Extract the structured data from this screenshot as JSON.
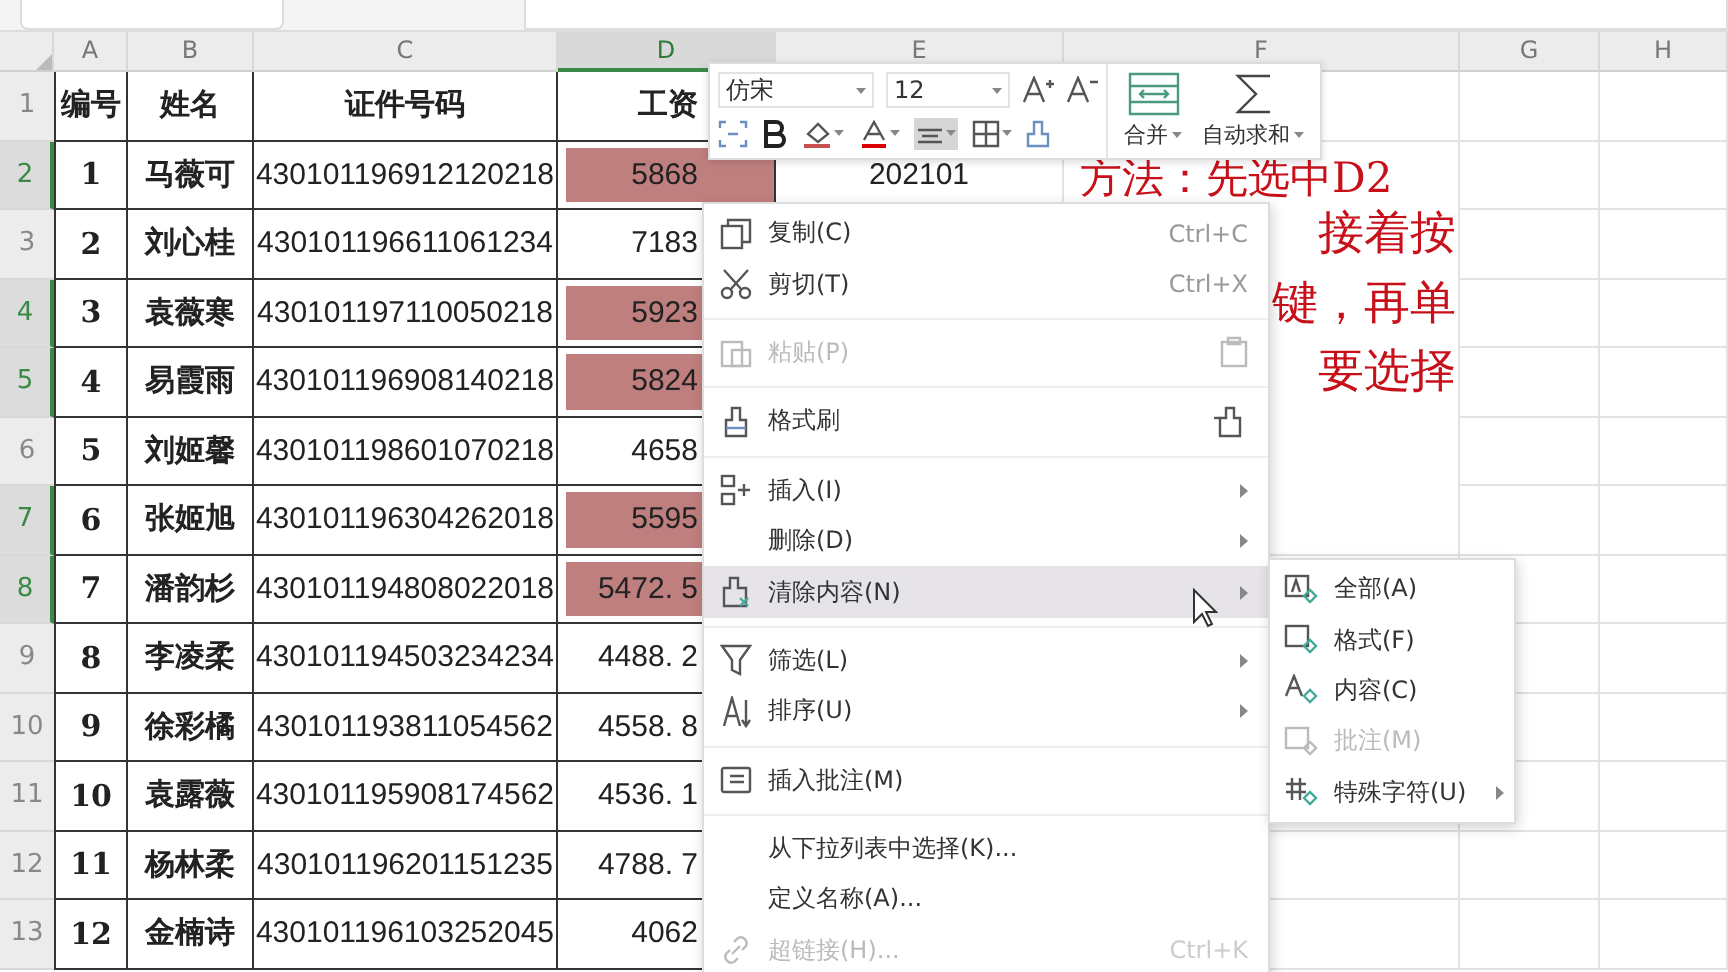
{
  "column_headers": [
    {
      "label": "A",
      "selected": false
    },
    {
      "label": "B",
      "selected": false
    },
    {
      "label": "C",
      "selected": false
    },
    {
      "label": "D",
      "selected": true
    },
    {
      "label": "E",
      "selected": false
    },
    {
      "label": "F",
      "selected": false
    },
    {
      "label": "G",
      "selected": false
    },
    {
      "label": "H",
      "selected": false
    }
  ],
  "rows": [
    {
      "row_number": "1",
      "selected": false,
      "kind": "header",
      "id": "编号",
      "name": "姓名",
      "id_number": "证件号码",
      "salary": "工资",
      "highlighted": false
    },
    {
      "row_number": "2",
      "selected": true,
      "kind": "data",
      "id": "1",
      "name": "马薇可",
      "id_number": "430101196912120218",
      "salary": "5868",
      "highlighted": true,
      "column_e": "202101"
    },
    {
      "row_number": "3",
      "selected": false,
      "kind": "data",
      "id": "2",
      "name": "刘心桂",
      "id_number": "430101196611061234",
      "salary": "7183",
      "highlighted": false
    },
    {
      "row_number": "4",
      "selected": true,
      "kind": "data",
      "id": "3",
      "name": "袁薇寒",
      "id_number": "430101197110050218",
      "salary": "5923",
      "highlighted": true
    },
    {
      "row_number": "5",
      "selected": true,
      "kind": "data",
      "id": "4",
      "name": "易霞雨",
      "id_number": "430101196908140218",
      "salary": "5824",
      "highlighted": true
    },
    {
      "row_number": "6",
      "selected": false,
      "kind": "data",
      "id": "5",
      "name": "刘姬馨",
      "id_number": "430101198601070218",
      "salary": "4658",
      "highlighted": false
    },
    {
      "row_number": "7",
      "selected": true,
      "kind": "data",
      "id": "6",
      "name": "张姬旭",
      "id_number": "430101196304262018",
      "salary": "5595",
      "highlighted": true
    },
    {
      "row_number": "8",
      "selected": true,
      "kind": "data",
      "id": "7",
      "name": "潘韵杉",
      "id_number": "430101194808022018",
      "salary": "5472. 5",
      "highlighted": true
    },
    {
      "row_number": "9",
      "selected": false,
      "kind": "data",
      "id": "8",
      "name": "李凌柔",
      "id_number": "430101194503234234",
      "salary": "4488. 2",
      "highlighted": false
    },
    {
      "row_number": "10",
      "selected": false,
      "kind": "data",
      "id": "9",
      "name": "徐彩橘",
      "id_number": "430101193811054562",
      "salary": "4558. 8",
      "highlighted": false
    },
    {
      "row_number": "11",
      "selected": false,
      "kind": "data",
      "id": "10",
      "name": "袁露薇",
      "id_number": "430101195908174562",
      "salary": "4536. 1",
      "highlighted": false
    },
    {
      "row_number": "12",
      "selected": false,
      "kind": "data",
      "id": "11",
      "name": "杨林柔",
      "id_number": "430101196201151235",
      "salary": "4788. 7",
      "highlighted": false
    },
    {
      "row_number": "13",
      "selected": false,
      "kind": "data",
      "id": "12",
      "name": "金楠诗",
      "id_number": "430101196103252045",
      "salary": "4062",
      "highlighted": false
    }
  ],
  "note_lines": [
    "方法：先选中D2",
    "接着按",
    "键，再单",
    "要选择"
  ],
  "mini_toolbar": {
    "font": "仿宋",
    "size": "12",
    "merge": "合并",
    "autosum": "自动求和"
  },
  "context_menu": [
    {
      "kind": "item",
      "label": "复制(C)",
      "shortcut": "Ctrl+C",
      "disabled": false,
      "selected": false,
      "has_submenu": false
    },
    {
      "kind": "item",
      "label": "剪切(T)",
      "shortcut": "Ctrl+X",
      "disabled": false,
      "selected": false,
      "has_submenu": false
    },
    {
      "kind": "separator"
    },
    {
      "kind": "item",
      "label": "粘贴(P)",
      "disabled": true,
      "selected": false,
      "has_submenu": false
    },
    {
      "kind": "separator"
    },
    {
      "kind": "item",
      "label": "格式刷",
      "disabled": false,
      "selected": false,
      "has_submenu": false
    },
    {
      "kind": "separator"
    },
    {
      "kind": "item",
      "label": "插入(I)",
      "disabled": false,
      "selected": false,
      "has_submenu": true
    },
    {
      "kind": "item",
      "label": "删除(D)",
      "disabled": false,
      "selected": false,
      "has_submenu": true
    },
    {
      "kind": "item",
      "label": "清除内容(N)",
      "disabled": false,
      "selected": true,
      "has_submenu": true
    },
    {
      "kind": "separator"
    },
    {
      "kind": "item",
      "label": "筛选(L)",
      "disabled": false,
      "selected": false,
      "has_submenu": true
    },
    {
      "kind": "item",
      "label": "排序(U)",
      "disabled": false,
      "selected": false,
      "has_submenu": true
    },
    {
      "kind": "separator"
    },
    {
      "kind": "item",
      "label": "插入批注(M)",
      "disabled": false,
      "selected": false,
      "has_submenu": false
    },
    {
      "kind": "separator"
    },
    {
      "kind": "item",
      "label": "从下拉列表中选择(K)...",
      "disabled": false,
      "selected": false,
      "has_submenu": false
    },
    {
      "kind": "item",
      "label": "定义名称(A)...",
      "disabled": false,
      "selected": false,
      "has_submenu": false
    },
    {
      "kind": "item",
      "label": "超链接(H)...",
      "shortcut": "Ctrl+K",
      "disabled": true,
      "selected": false,
      "has_submenu": false
    }
  ],
  "submenu": [
    {
      "label": "全部(A)",
      "disabled": false,
      "has_submenu": false
    },
    {
      "label": "格式(F)",
      "disabled": false,
      "has_submenu": false
    },
    {
      "label": "内容(C)",
      "disabled": false,
      "has_submenu": false
    },
    {
      "label": "批注(M)",
      "disabled": true,
      "has_submenu": false
    },
    {
      "label": "特殊字符(U)",
      "disabled": false,
      "has_submenu": true
    }
  ]
}
